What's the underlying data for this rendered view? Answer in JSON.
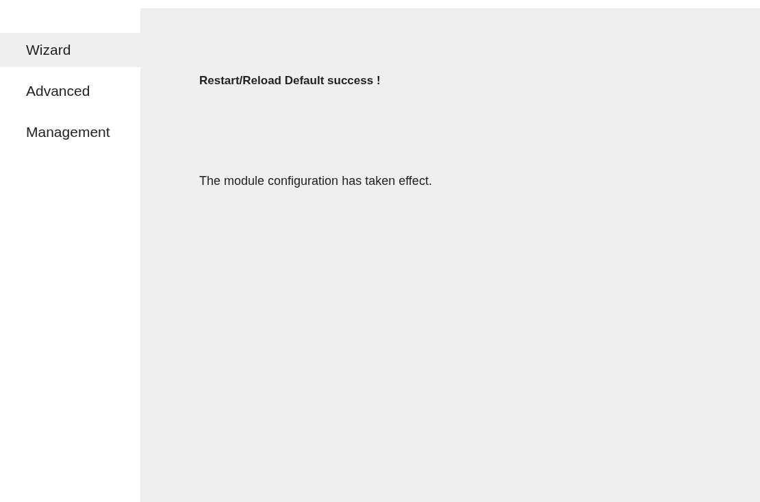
{
  "sidebar": {
    "items": [
      {
        "label": "Wizard",
        "selected": true
      },
      {
        "label": "Advanced",
        "selected": false
      },
      {
        "label": "Management",
        "selected": false
      }
    ]
  },
  "content": {
    "title": "Restart/Reload Default success !",
    "message": "The module configuration has taken effect."
  }
}
